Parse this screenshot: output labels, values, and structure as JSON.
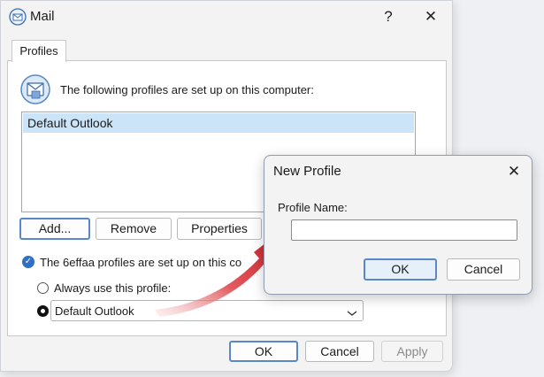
{
  "mail_dialog": {
    "title": "Mail",
    "help_label": "?",
    "close_label": "✕",
    "tab_label": "Profiles",
    "intro_text": "The following profiles are set up on this computer:",
    "profiles": [
      "Default Outlook"
    ],
    "buttons": {
      "add": "Add...",
      "remove": "Remove",
      "properties": "Properties"
    },
    "startup_text": "The 6effaa profiles are set up on this co",
    "radio_always": "Always use this profile:",
    "selected_profile": "Default Outlook",
    "footer": {
      "ok": "OK",
      "cancel": "Cancel",
      "apply": "Apply"
    }
  },
  "new_profile_dialog": {
    "title": "New Profile",
    "close_label": "✕",
    "field_label": "Profile Name:",
    "field_value": "",
    "ok": "OK",
    "cancel": "Cancel"
  },
  "colors": {
    "selection": "#cce4f7",
    "default_button_border": "#5a87c7",
    "arrow": "#d6202a"
  },
  "icons": [
    "mail-app-icon",
    "profile-book-icon",
    "chevron-down-icon",
    "red-arrow-annotation"
  ]
}
